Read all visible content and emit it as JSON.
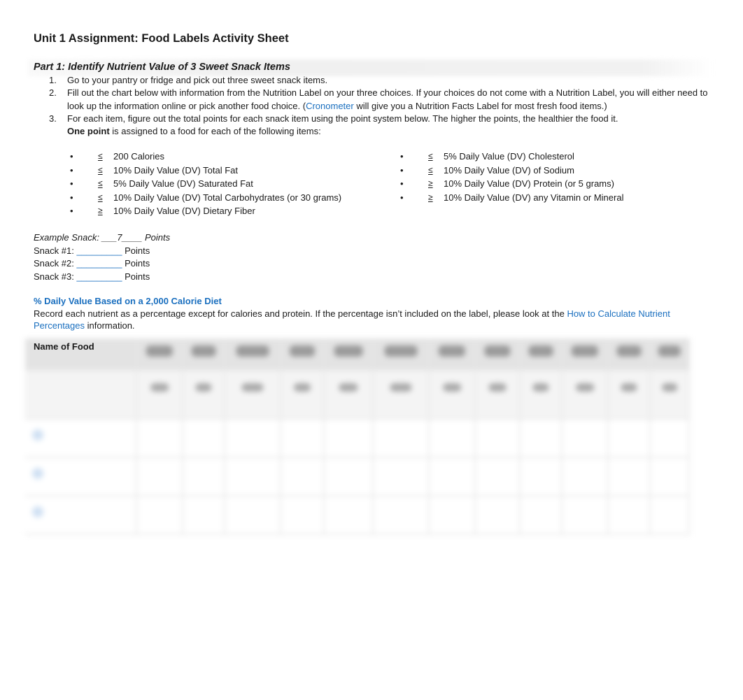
{
  "document": {
    "title": "Unit 1 Assignment: Food Labels Activity Sheet",
    "part1": {
      "heading": "Part 1: Identify Nutrient Value of 3 Sweet Snack Items",
      "steps": [
        {
          "num": "1.",
          "text": "Go to your pantry or fridge and pick out three sweet snack items."
        },
        {
          "num": "2.",
          "text_before_link": "Fill out the chart below with information from the Nutrition Label on your three choices. If your choices do not come with a Nutrition Label, you will either need to look up the information online or pick another food choice.  (",
          "link": "Cronometer",
          "text_after_link": " will give you a Nutrition Facts Label for most fresh food items.)"
        },
        {
          "num": "3.",
          "text": "For each item, figure out the total points for each snack item using the point system below. The higher the points, the healthier the food it.",
          "sub_bold": "One point",
          "sub_rest": " is assigned to a food for each of the following items:"
        }
      ]
    },
    "criteria_left": [
      {
        "bullet": "•",
        "cmp": "≤",
        "text": "200 Calories"
      },
      {
        "bullet": "•",
        "cmp": "≤",
        "text": "10% Daily Value (DV) Total Fat"
      },
      {
        "bullet": "•",
        "cmp": "≤",
        "text": "5% Daily Value (DV) Saturated Fat"
      },
      {
        "bullet": "•",
        "cmp": "≤",
        "text": "10% Daily Value (DV) Total Carbohydrates (or 30 grams)"
      },
      {
        "bullet": "•",
        "cmp": "≥",
        "text": "10% Daily Value (DV) Dietary Fiber"
      }
    ],
    "criteria_right": [
      {
        "bullet": "•",
        "cmp": "≤",
        "text": "5% Daily Value (DV) Cholesterol"
      },
      {
        "bullet": "•",
        "cmp": "≤",
        "text": "10% Daily Value (DV) of Sodium"
      },
      {
        "bullet": "•",
        "cmp": "≥",
        "text": "10% Daily Value (DV) Protein (or 5 grams)"
      },
      {
        "bullet": "•",
        "cmp": "≥",
        "text": "10% Daily Value (DV) any Vitamin or Mineral"
      }
    ],
    "snacks": {
      "example": "Example Snack: ___7____ Points",
      "rows": [
        {
          "label": "Snack #1: ",
          "blank": "_________",
          "suffix": " Points"
        },
        {
          "label": "Snack #2: ",
          "blank": "_________",
          "suffix": " Points"
        },
        {
          "label": "Snack #3: ",
          "blank": "_________",
          "suffix": " Points"
        }
      ]
    },
    "daily_value": {
      "heading": "% Daily Value Based on a 2,000 Calorie Diet",
      "text_before_link": "Record each nutrient as a percentage except for calories and protein.  If the percentage isn’t included on the label, please look at the ",
      "link": "How to Calculate Nutrient Percentages",
      "text_after_link": " information."
    },
    "table": {
      "first_header": "Name of Food",
      "obscured": true
    }
  }
}
